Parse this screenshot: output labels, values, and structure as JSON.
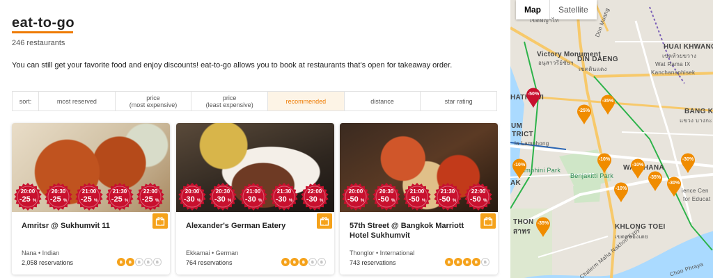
{
  "header": {
    "title": "eat-to-go",
    "count": "246 restaurants",
    "intro": "You can still get your favorite food and enjoy discounts! eat-to-go allows you to book at restaurants that’s open for takeaway order."
  },
  "sort": {
    "label": "sort:",
    "options": [
      {
        "label": "most reserved"
      },
      {
        "label": "price\n(most expensive)"
      },
      {
        "label": "price\n(least expensive)"
      },
      {
        "label": "recommended",
        "active": true
      },
      {
        "label": "distance"
      },
      {
        "label": "star rating"
      }
    ]
  },
  "restaurants": [
    {
      "name": "Amritsr @ Sukhumvit 11",
      "meta": "Nana • Indian",
      "reservations": "2,058 reservations",
      "price_level": 2,
      "slots": [
        {
          "time": "20:00",
          "discount": "-25",
          "unit": "%"
        },
        {
          "time": "20:30",
          "discount": "-25",
          "unit": "%"
        },
        {
          "time": "21:00",
          "discount": "-25",
          "unit": "%"
        },
        {
          "time": "21:30",
          "discount": "-25",
          "unit": "%"
        },
        {
          "time": "22:00",
          "discount": "-25",
          "unit": "%"
        }
      ]
    },
    {
      "name": "Alexander's German Eatery",
      "meta": "Ekkamai • German",
      "reservations": "764 reservations",
      "price_level": 3,
      "slots": [
        {
          "time": "20:00",
          "discount": "-30",
          "unit": "%"
        },
        {
          "time": "20:30",
          "discount": "-30",
          "unit": "%"
        },
        {
          "time": "21:00",
          "discount": "-30",
          "unit": "%"
        },
        {
          "time": "21:30",
          "discount": "-30",
          "unit": "%"
        },
        {
          "time": "22:00",
          "discount": "-30",
          "unit": "%"
        }
      ]
    },
    {
      "name": "57th Street @ Bangkok Marriott Hotel Sukhumvit",
      "meta": "Thonglor • International",
      "reservations": "743 reservations",
      "price_level": 4,
      "slots": [
        {
          "time": "20:00",
          "discount": "-50",
          "unit": "%"
        },
        {
          "time": "20:30",
          "discount": "-50",
          "unit": "%"
        },
        {
          "time": "21:00",
          "discount": "-50",
          "unit": "%"
        },
        {
          "time": "21:30",
          "discount": "-50",
          "unit": "%"
        },
        {
          "time": "22:00",
          "discount": "-50",
          "unit": "%"
        }
      ]
    }
  ],
  "map": {
    "tabs": [
      "Map",
      "Satellite"
    ],
    "labels": [
      {
        "text": "เขตพญาไท"
      },
      {
        "text": "Victory Monument"
      },
      {
        "text": "อนุสาวรีย์ชัยฯ"
      },
      {
        "text": "HUAI KHWANG"
      },
      {
        "text": "เขตห้วยขวาง"
      },
      {
        "text": "Wat Rama IX"
      },
      {
        "text": "Kanchanaphisek"
      },
      {
        "text": "DIN DAENG"
      },
      {
        "text": "เขตดินแดง"
      },
      {
        "text": "BANG KAP"
      },
      {
        "text": "แขวง บางกะ"
      },
      {
        "text": "UM"
      },
      {
        "text": "TRICT"
      },
      {
        "text": "la Lamphong"
      },
      {
        "text": "umphini Park"
      },
      {
        "text": "Benjakitti Park"
      },
      {
        "text": "WATTHANA"
      },
      {
        "text": "ience Cen"
      },
      {
        "text": "for Educat"
      },
      {
        "text": "KHLONG TOEI"
      },
      {
        "text": "เขตคลองเตย"
      },
      {
        "text": "Don Muang"
      },
      {
        "text": "Chalerm Maha Nakhon Expy"
      },
      {
        "text": "Chao Phraya"
      },
      {
        "text": "THON"
      },
      {
        "text": "สาทร"
      },
      {
        "text": "AK"
      },
      {
        "text": "HATHEWI"
      }
    ],
    "pins": [
      {
        "label": "-50%",
        "color": "#c8102e"
      },
      {
        "label": "-35%",
        "color": "#f08c00"
      },
      {
        "label": "-25%",
        "color": "#f08c00"
      },
      {
        "label": "-10%",
        "color": "#f08c00"
      },
      {
        "label": "-10%",
        "color": "#f08c00"
      },
      {
        "label": "-10%",
        "color": "#f08c00"
      },
      {
        "label": "-30%",
        "color": "#f08c00"
      },
      {
        "label": "-35%",
        "color": "#f08c00"
      },
      {
        "label": "-30%",
        "color": "#f08c00"
      },
      {
        "label": "-10%",
        "color": "#f08c00"
      },
      {
        "label": "-35%",
        "color": "#f08c00"
      }
    ]
  },
  "colors": {
    "accent": "#ee7a00",
    "seal": "#c8102e",
    "gift": "#f5a21b"
  }
}
